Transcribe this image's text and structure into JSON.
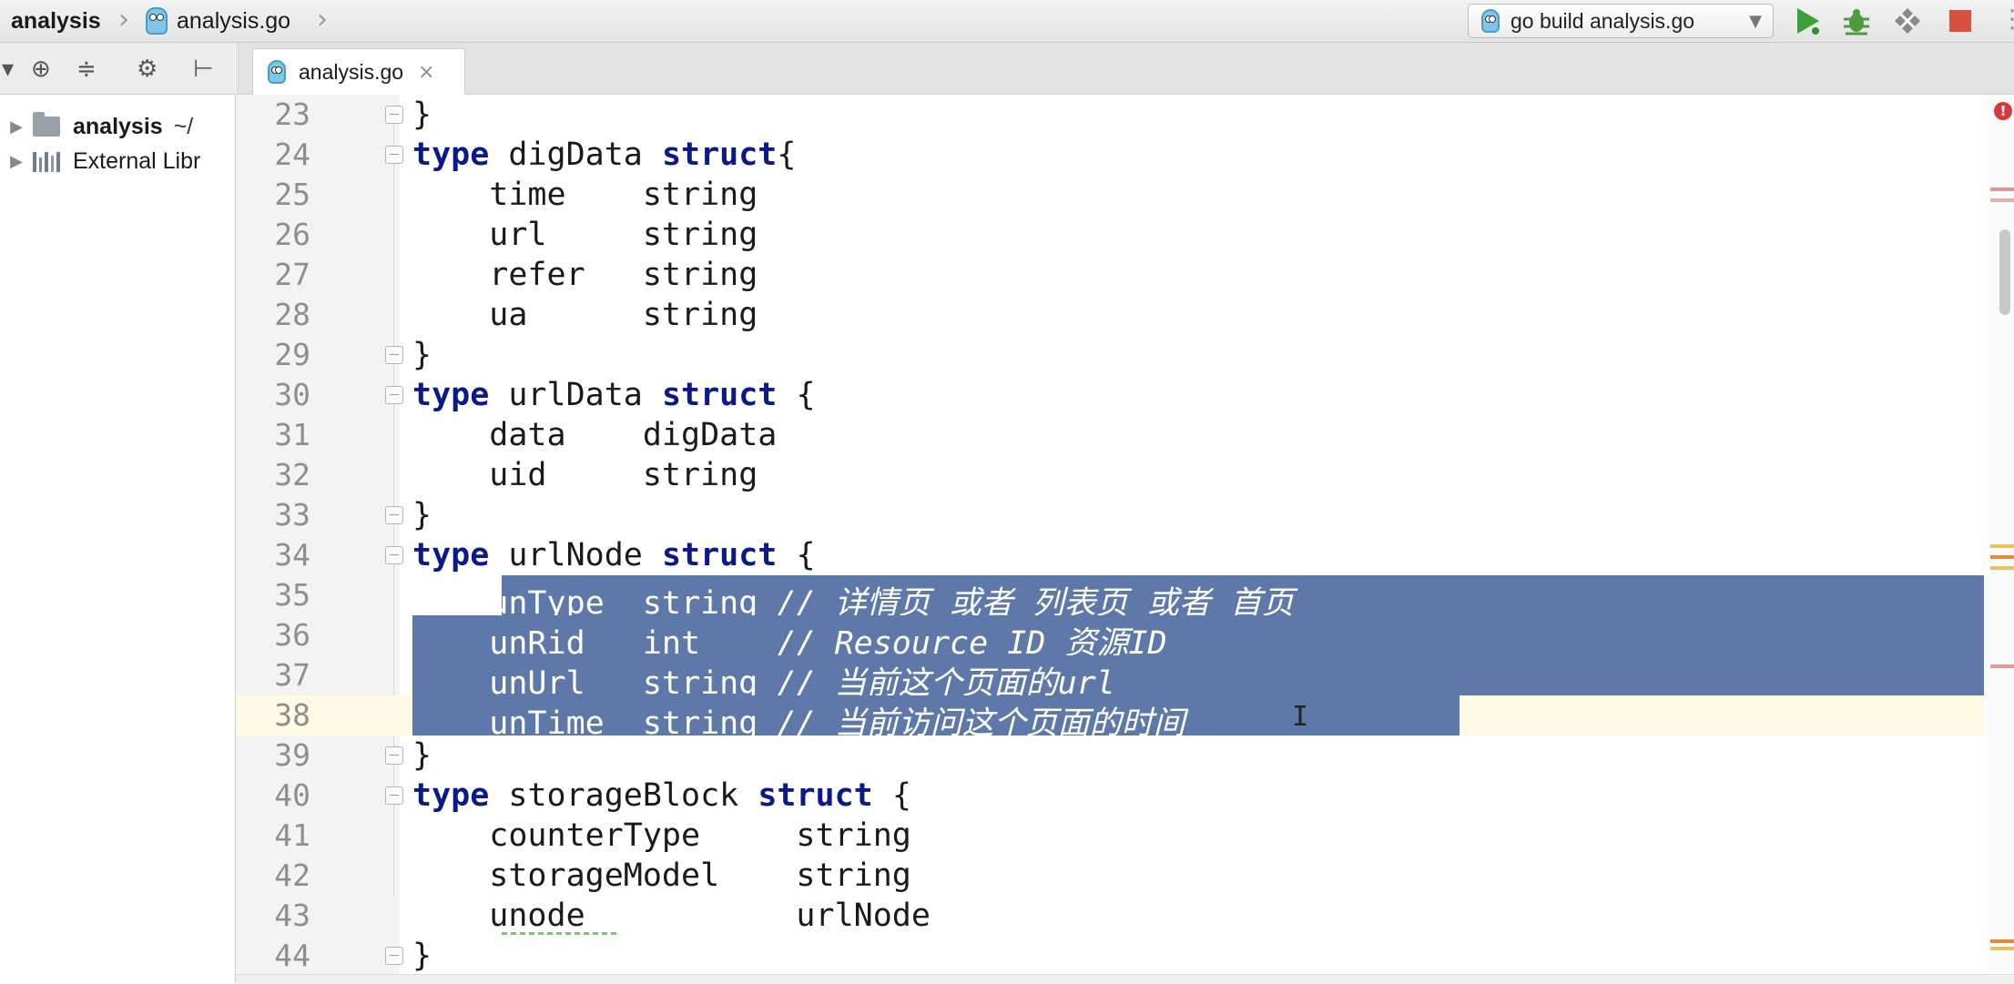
{
  "breadcrumb": {
    "project": "analysis",
    "file": "analysis.go"
  },
  "run_config": {
    "label": "go build analysis.go"
  },
  "toolbar_icons": [
    "run-icon",
    "debug-icon",
    "coverage-icon",
    "stop-icon"
  ],
  "project_tree": {
    "items": [
      {
        "label": "analysis",
        "suffix": "~/",
        "type": "folder"
      },
      {
        "label": "External Libr",
        "type": "libraries"
      }
    ]
  },
  "tabs": [
    {
      "label": "analysis.go",
      "close": "×"
    }
  ],
  "editor": {
    "lines": [
      {
        "n": "23",
        "text": "}"
      },
      {
        "n": "24",
        "text": "type digData struct{"
      },
      {
        "n": "25",
        "text": "    time    string"
      },
      {
        "n": "26",
        "text": "    url     string"
      },
      {
        "n": "27",
        "text": "    refer   string"
      },
      {
        "n": "28",
        "text": "    ua      string"
      },
      {
        "n": "29",
        "text": "}"
      },
      {
        "n": "30",
        "text": "type urlData struct {"
      },
      {
        "n": "31",
        "text": "    data    digData"
      },
      {
        "n": "32",
        "text": "    uid     string"
      },
      {
        "n": "33",
        "text": "}"
      },
      {
        "n": "34",
        "text": "type urlNode struct {"
      },
      {
        "n": "35",
        "text": "    unType  string // 详情页 或者 列表页 或者 首页"
      },
      {
        "n": "36",
        "text": "    unRid   int    // Resource ID 资源ID"
      },
      {
        "n": "37",
        "text": "    unUrl   string // 当前这个页面的url"
      },
      {
        "n": "38",
        "text": "    unTime  string // 当前访问这个页面的时间"
      },
      {
        "n": "39",
        "text": "}"
      },
      {
        "n": "40",
        "text": "type storageBlock struct {"
      },
      {
        "n": "41",
        "text": "    counterType     string"
      },
      {
        "n": "42",
        "text": "    storageModel    string"
      },
      {
        "n": "43",
        "text": "    unode           urlNode"
      },
      {
        "n": "44",
        "text": "}"
      }
    ]
  },
  "colors": {
    "keyword": "#0b1a8a",
    "selection": "#5e78aa",
    "caret_line": "#fffae3",
    "gutter": "#f3f3f3"
  }
}
